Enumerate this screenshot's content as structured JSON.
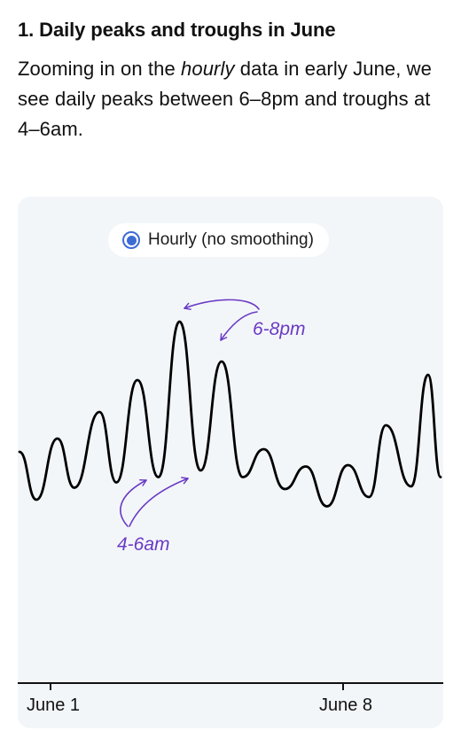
{
  "heading": "1. Daily peaks and troughs in June",
  "description": {
    "part1": "Zooming in on the ",
    "emphasis": "hourly",
    "part2": " data in early June, we see daily peaks between 6–8pm and troughs at 4–6am."
  },
  "legend": {
    "label": "Hourly (no smoothing)",
    "selected": true
  },
  "colors": {
    "line": "#000000",
    "annotation": "#6a3bc4",
    "accent": "#3d6bd6",
    "panel_bg": "#f3f6f9"
  },
  "chart_data": {
    "type": "line",
    "x_ticks": [
      "June 1",
      "June 8"
    ],
    "grid": false,
    "legend_position": "top-center",
    "series": [
      {
        "name": "Hourly (no smoothing)",
        "peaks": [
          {
            "day": 0,
            "value": 50
          },
          {
            "day": 0.9,
            "value": 60
          },
          {
            "day": 1.9,
            "value": 80
          },
          {
            "day": 2.8,
            "value": 104
          },
          {
            "day": 3.8,
            "value": 148
          },
          {
            "day": 4.8,
            "value": 118
          },
          {
            "day": 5.8,
            "value": 52
          },
          {
            "day": 6.8,
            "value": 39
          },
          {
            "day": 7.8,
            "value": 40
          },
          {
            "day": 8.7,
            "value": 70
          },
          {
            "day": 9.7,
            "value": 108
          }
        ],
        "troughs": [
          {
            "day": 0.4,
            "value": 14
          },
          {
            "day": 1.3,
            "value": 23
          },
          {
            "day": 2.3,
            "value": 27
          },
          {
            "day": 3.3,
            "value": 31
          },
          {
            "day": 4.3,
            "value": 36
          },
          {
            "day": 5.3,
            "value": 31
          },
          {
            "day": 6.3,
            "value": 22
          },
          {
            "day": 7.3,
            "value": 9
          },
          {
            "day": 8.3,
            "value": 16
          },
          {
            "day": 9.3,
            "value": 24
          },
          {
            "day": 10,
            "value": 31
          }
        ]
      }
    ],
    "annotations": [
      {
        "label": "6-8pm",
        "points_to": "peaks"
      },
      {
        "label": "4-6am",
        "points_to": "troughs"
      }
    ]
  }
}
